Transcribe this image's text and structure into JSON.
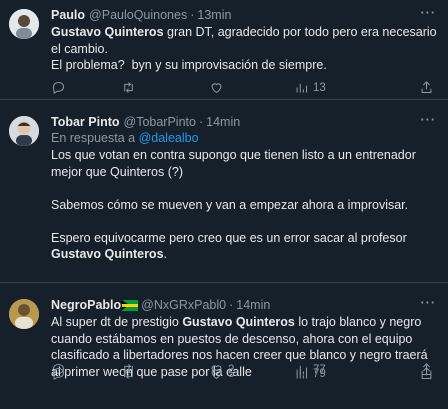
{
  "tweets": [
    {
      "name": "Paulo",
      "handle": "@PauloQuinones",
      "time": "13min",
      "reply_to_prefix": "",
      "reply_to_handle": "",
      "body_html": "<b>Gustavo Quinteros</b> gran DT, agradecido por todo pero era necesario el cambio.\nEl problema?  byn y su improvisación de siempre.",
      "replies": "",
      "retweets": "",
      "likes": "",
      "views": "13"
    },
    {
      "name": "Tobar Pinto",
      "handle": "@TobarPinto",
      "time": "14min",
      "reply_to_prefix": "En respuesta a",
      "reply_to_handle": "@dalealbo",
      "body_html": "Los que votan en contra supongo que tienen listo a un entrenador mejor que Quinteros (?)\n\nSabemos cómo se mueven y van a empezar ahora a improvisar.\n\nEspero equivocarme pero creo que es un error sacar al profesor <b>Gustavo Quinteros</b>.",
      "replies": "",
      "retweets": "",
      "likes": "2",
      "views": "77"
    },
    {
      "name": "NegroPablo",
      "handle": "@NxGRxPabl0",
      "time": "14min",
      "reply_to_prefix": "",
      "reply_to_handle": "",
      "body_html": "Al super dt de prestigio <b>Gustavo Quinteros</b> lo trajo blanco y negro cuando estábamos en puestos de descenso, ahora con el equipo clasificado a libertadores nos hacen creer que blanco y negro traerá al primer weon que pase por la calle",
      "replies": "",
      "retweets": "",
      "likes": "5",
      "views": "79"
    }
  ],
  "more_label": "···",
  "dot": "·",
  "colors": {
    "background": "#15202b",
    "text": "#e7e9ea",
    "muted": "#8b98a5",
    "link": "#1d9bf0",
    "divider": "#38444d"
  }
}
